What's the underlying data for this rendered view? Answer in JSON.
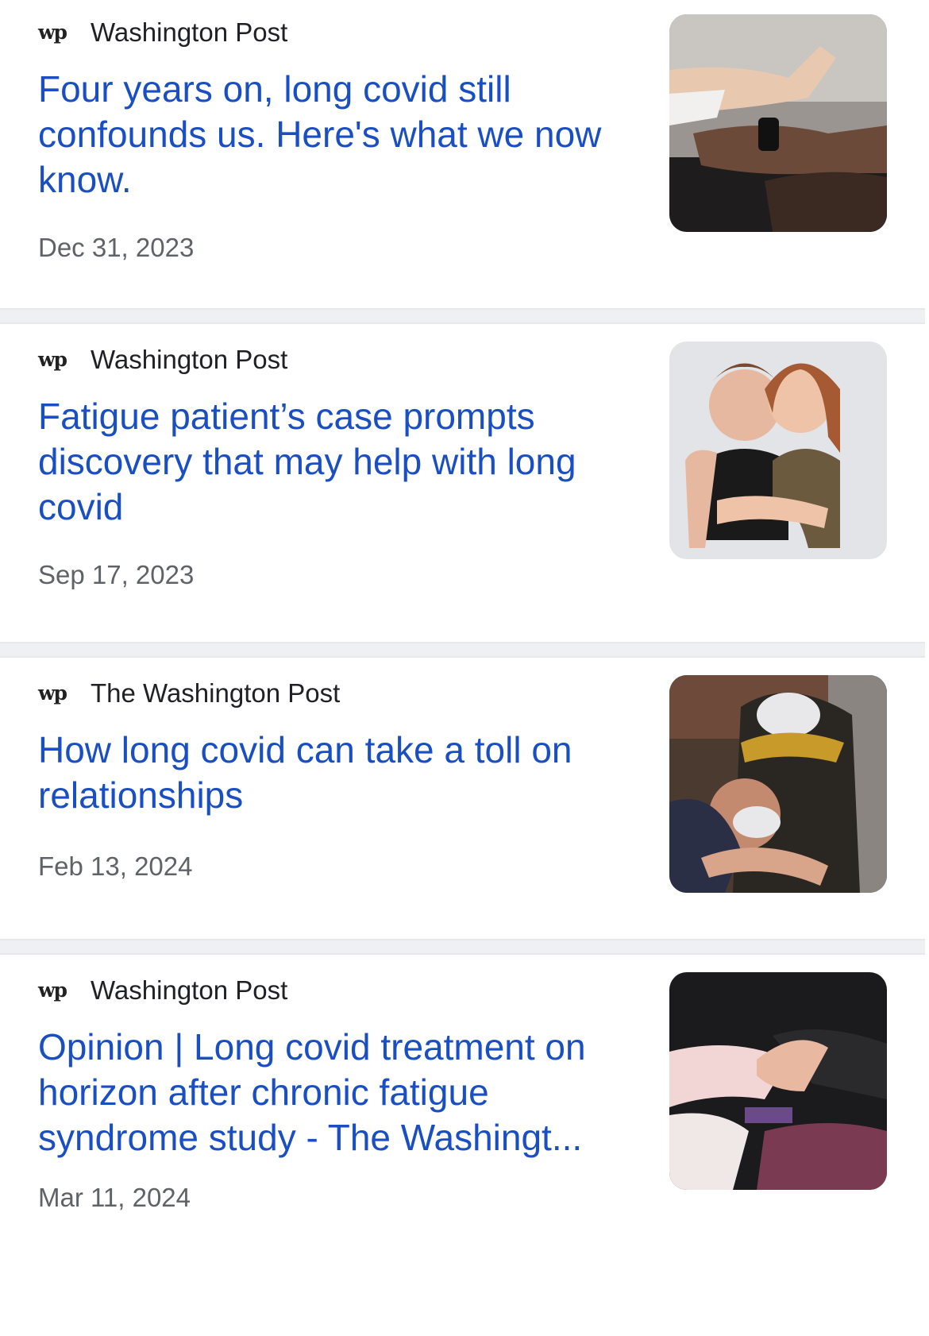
{
  "articles": [
    {
      "source_logo": "wp",
      "source": "Washington Post",
      "headline": "Four years on, long covid still confounds us. Here's what we now know.",
      "date": "Dec 31, 2023",
      "image_icon": "hands-photo"
    },
    {
      "source_logo": "wp",
      "source": "Washington Post",
      "headline": "Fatigue patient’s case prompts discovery that may help with long covid",
      "date": "Sep 17, 2023",
      "image_icon": "mother-daughter-photo"
    },
    {
      "source_logo": "wp",
      "source": "The Washington Post",
      "headline": "How long covid can take a toll on relationships",
      "date": "Feb 13, 2024",
      "image_icon": "couple-embrace-photo"
    },
    {
      "source_logo": "wp",
      "source": "Washington Post",
      "headline": "Opinion | Long covid treatment on horizon after chronic fatigue syndrome study - The Washingt...",
      "date": "Mar 11, 2024",
      "image_icon": "holding-hands-photo"
    }
  ],
  "colors": {
    "headline": "#1a4fc4",
    "source": "#202124",
    "date": "#5f6368",
    "separator": "#eef0f3"
  }
}
